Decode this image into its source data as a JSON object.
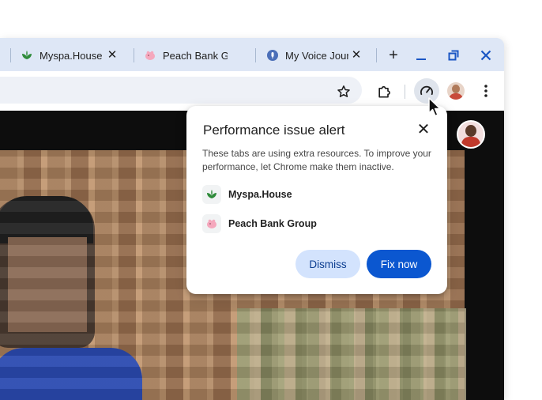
{
  "tabs": [
    {
      "title": "Myspa.House",
      "favicon": "leaf-icon"
    },
    {
      "title": "Peach Bank Gr",
      "favicon": "piggy-bank-icon"
    },
    {
      "title": "My Voice Journ",
      "favicon": "microphone-icon"
    }
  ],
  "window_controls": {
    "new_tab": "+",
    "minimize": "minimize-icon",
    "restore": "restore-icon",
    "close": "close-icon"
  },
  "popup": {
    "title": "Performance issue alert",
    "close": "✕",
    "description": "These tabs are using extra resources. To improve your performance, let Chrome make them inactive.",
    "sites": [
      {
        "name": "Myspa.House",
        "favicon": "leaf-icon"
      },
      {
        "name": "Peach Bank Group",
        "favicon": "piggy-bank-icon"
      }
    ],
    "dismiss": "Dismiss",
    "fix_now": "Fix now"
  },
  "colors": {
    "accent": "#0b57d0",
    "tonal": "#d3e3fd",
    "tabstrip": "#dee7f6"
  }
}
